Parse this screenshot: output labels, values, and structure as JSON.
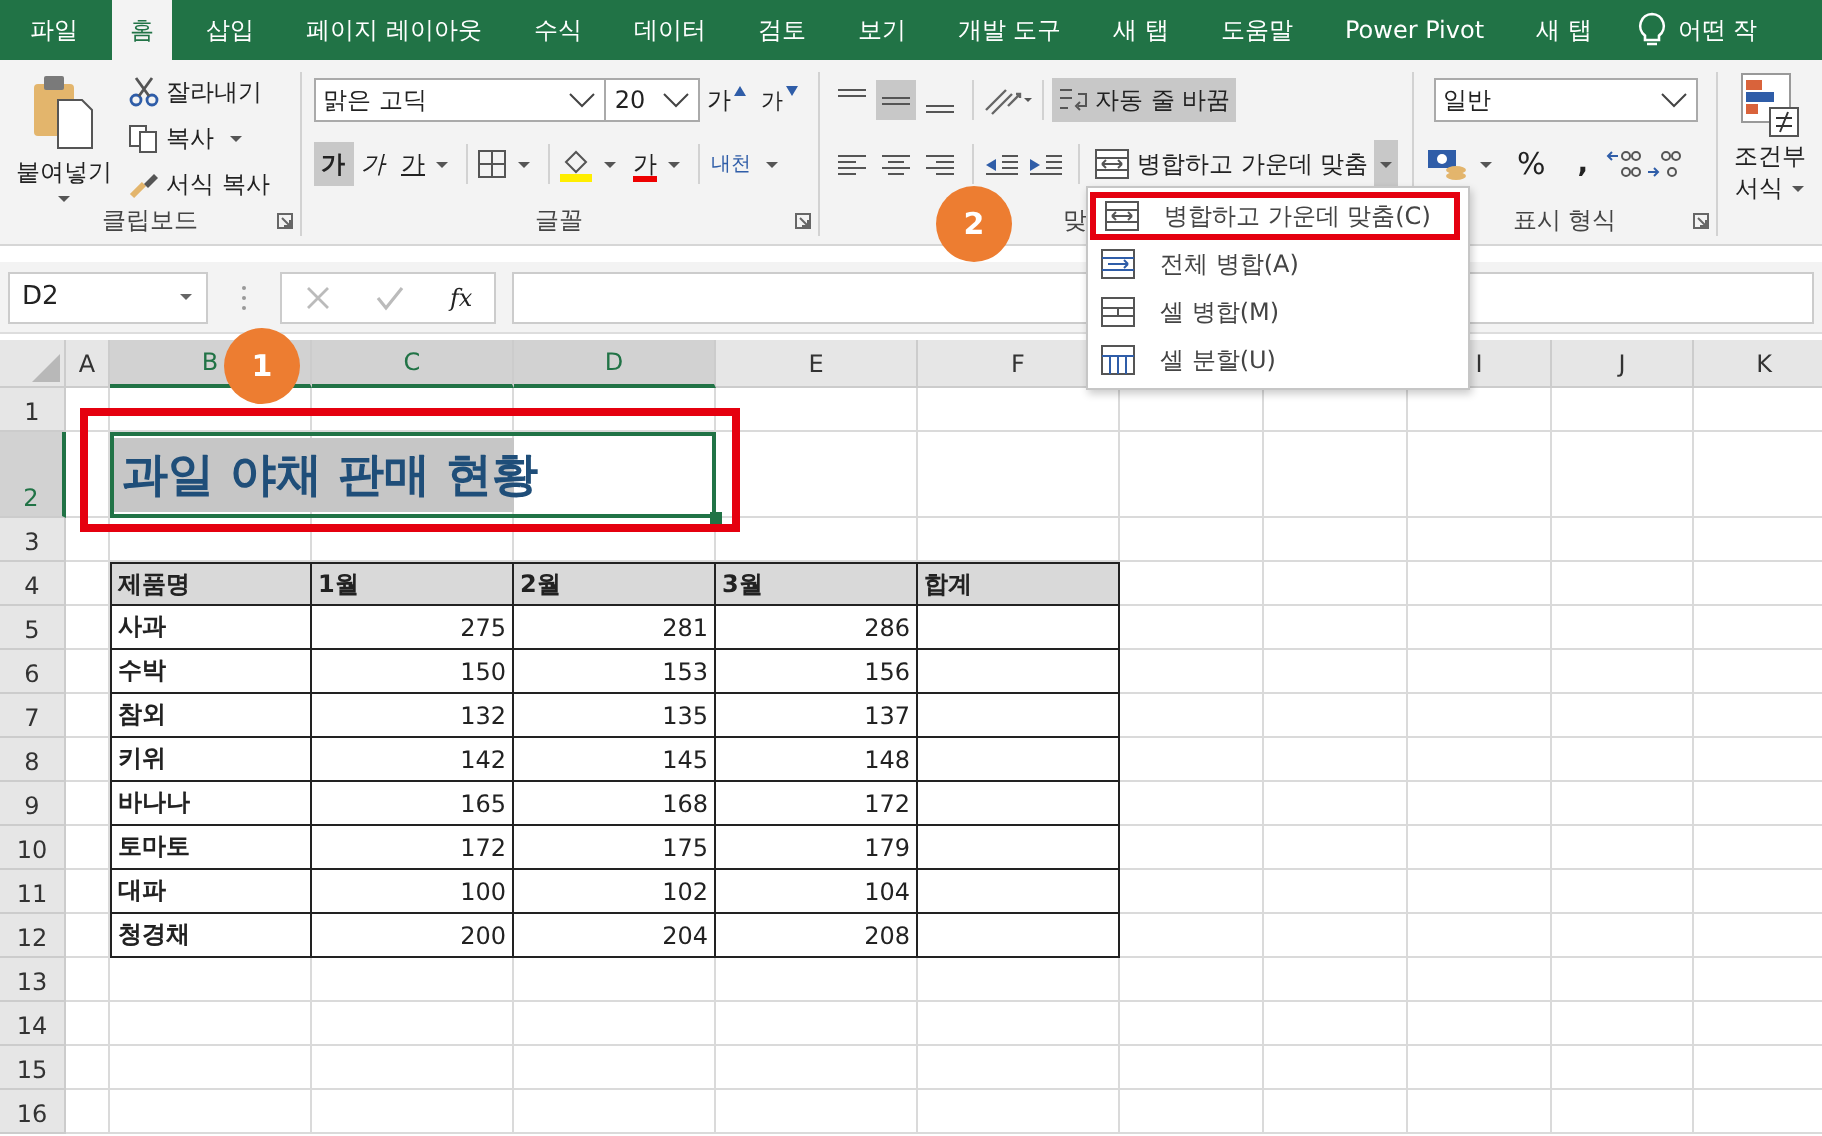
{
  "tabs": [
    {
      "label": "파일",
      "selected": false
    },
    {
      "label": "홈",
      "selected": true
    },
    {
      "label": "삽입",
      "selected": false
    },
    {
      "label": "페이지 레이아웃",
      "selected": false
    },
    {
      "label": "수식",
      "selected": false
    },
    {
      "label": "데이터",
      "selected": false
    },
    {
      "label": "검토",
      "selected": false
    },
    {
      "label": "보기",
      "selected": false
    },
    {
      "label": "개발 도구",
      "selected": false
    },
    {
      "label": "새 탭",
      "selected": false
    },
    {
      "label": "도움말",
      "selected": false
    },
    {
      "label": "Power Pivot",
      "selected": false
    },
    {
      "label": "새 탭",
      "selected": false
    }
  ],
  "tell_me": "어떤 작",
  "ribbon": {
    "clipboard": {
      "paste": "붙여넣기",
      "cut": "잘라내기",
      "copy": "복사",
      "format_painter": "서식 복사",
      "label": "클립보드"
    },
    "font": {
      "name": "맑은 고딕",
      "size": "20",
      "grow": "가",
      "shrink": "가",
      "bold": {
        "text": "가",
        "on": true
      },
      "italic": "가",
      "underline": "가",
      "font_color": "가",
      "phonetic": "내천",
      "label": "글꼴"
    },
    "alignment": {
      "middle_on": true,
      "wrap": {
        "text": "자동 줄 바꿈",
        "on": true
      },
      "merge": {
        "text": "병합하고 가운데 맞춤",
        "open": true
      },
      "label": "맞"
    },
    "number": {
      "format": "일반",
      "percent": "%",
      "comma": ",",
      "label": "표시 형식"
    },
    "styles": {
      "conditional": [
        "조건부",
        "서식"
      ]
    }
  },
  "formula_bar": {
    "name_box": "D2",
    "fx": "fx"
  },
  "merge_menu": [
    {
      "label": "병합하고 가운데 맞춤(C)",
      "selected": true
    },
    {
      "label": "전체 병합(A)",
      "selected": false
    },
    {
      "label": "셀 병합(M)",
      "selected": false
    },
    {
      "label": "셀 분할(U)",
      "selected": false
    }
  ],
  "sheet": {
    "columns": [
      {
        "label": "A",
        "selected": false
      },
      {
        "label": "B",
        "selected": true
      },
      {
        "label": "C",
        "selected": true
      },
      {
        "label": "D",
        "selected": true
      },
      {
        "label": "E",
        "selected": false
      },
      {
        "label": "F",
        "selected": false
      },
      {
        "label": "I",
        "selected": false
      },
      {
        "label": "J",
        "selected": false
      },
      {
        "label": "K",
        "selected": false
      }
    ],
    "rows": [
      {
        "label": "1",
        "selected": false
      },
      {
        "label": "2",
        "selected": true
      },
      {
        "label": "3",
        "selected": false
      },
      {
        "label": "4",
        "selected": false
      },
      {
        "label": "5",
        "selected": false
      },
      {
        "label": "6",
        "selected": false
      },
      {
        "label": "7",
        "selected": false
      },
      {
        "label": "8",
        "selected": false
      },
      {
        "label": "9",
        "selected": false
      },
      {
        "label": "10",
        "selected": false
      },
      {
        "label": "11",
        "selected": false
      },
      {
        "label": "12",
        "selected": false
      },
      {
        "label": "13",
        "selected": false
      },
      {
        "label": "14",
        "selected": false
      },
      {
        "label": "15",
        "selected": false
      },
      {
        "label": "16",
        "selected": false
      }
    ],
    "title": "과일 야채 판매 현황",
    "table": {
      "header": [
        "제품명",
        "1월",
        "2월",
        "3월",
        "합계"
      ],
      "rows": [
        [
          "사과",
          "275",
          "281",
          "286"
        ],
        [
          "수박",
          "150",
          "153",
          "156"
        ],
        [
          "참외",
          "132",
          "135",
          "137"
        ],
        [
          "키위",
          "142",
          "145",
          "148"
        ],
        [
          "바나나",
          "165",
          "168",
          "172"
        ],
        [
          "토마토",
          "172",
          "175",
          "179"
        ],
        [
          "대파",
          "100",
          "102",
          "104"
        ],
        [
          "청경채",
          "200",
          "204",
          "208"
        ]
      ]
    }
  },
  "callouts": [
    "1",
    "2"
  ]
}
